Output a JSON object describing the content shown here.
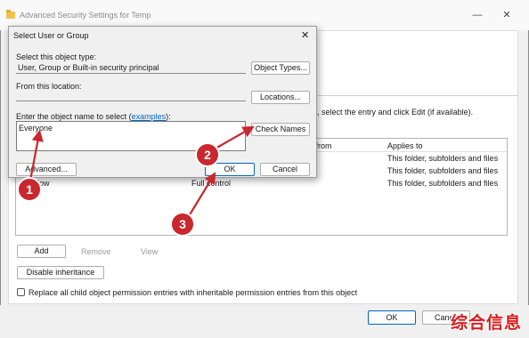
{
  "window": {
    "title": "Advanced Security Settings for Temp",
    "minimize": "—",
    "maximize": "□",
    "close": "✕"
  },
  "main": {
    "instruction": ", select the entry and click Edit (if available).",
    "columns": {
      "inherited": "d from",
      "applies": "Applies to"
    },
    "rows": [
      {
        "type": "",
        "access": "",
        "applies": "This folder, subfolders and files"
      },
      {
        "type": "",
        "access": "",
        "applies": "This folder, subfolders and files"
      },
      {
        "type": "llow",
        "access": "Full control",
        "applies": "This folder, subfolders and files"
      }
    ],
    "add_label": "Add",
    "remove_label": "Remove",
    "view_label": "View",
    "disable_inheritance_label": "Disable inheritance",
    "replace_label": "Replace all child object permission entries with inheritable permission entries from this object",
    "ok_label": "OK",
    "cancel_label": "Cance"
  },
  "dialog": {
    "title": "Select User or Group",
    "close": "✕",
    "object_type_label": "Select this object type:",
    "object_type_value": "User, Group or Built-in security principal",
    "object_types_button": "Object Types...",
    "location_label": "From this location:",
    "location_value": "",
    "locations_button": "Locations...",
    "enter_name_label": "Enter the object name to select (",
    "examples_link": "examples",
    "enter_name_suffix": "):",
    "name_value": "Everyone",
    "check_names_button": "Check Names",
    "advanced_button": "Advanced...",
    "ok_button": "OK",
    "cancel_button": "Cancel"
  },
  "annotations": {
    "badge1": "1",
    "badge2": "2",
    "badge3": "3"
  },
  "watermark": "综合信息",
  "colors": {
    "badge": "#c8282e",
    "link": "#0067c0",
    "accent": "#0067c0"
  }
}
